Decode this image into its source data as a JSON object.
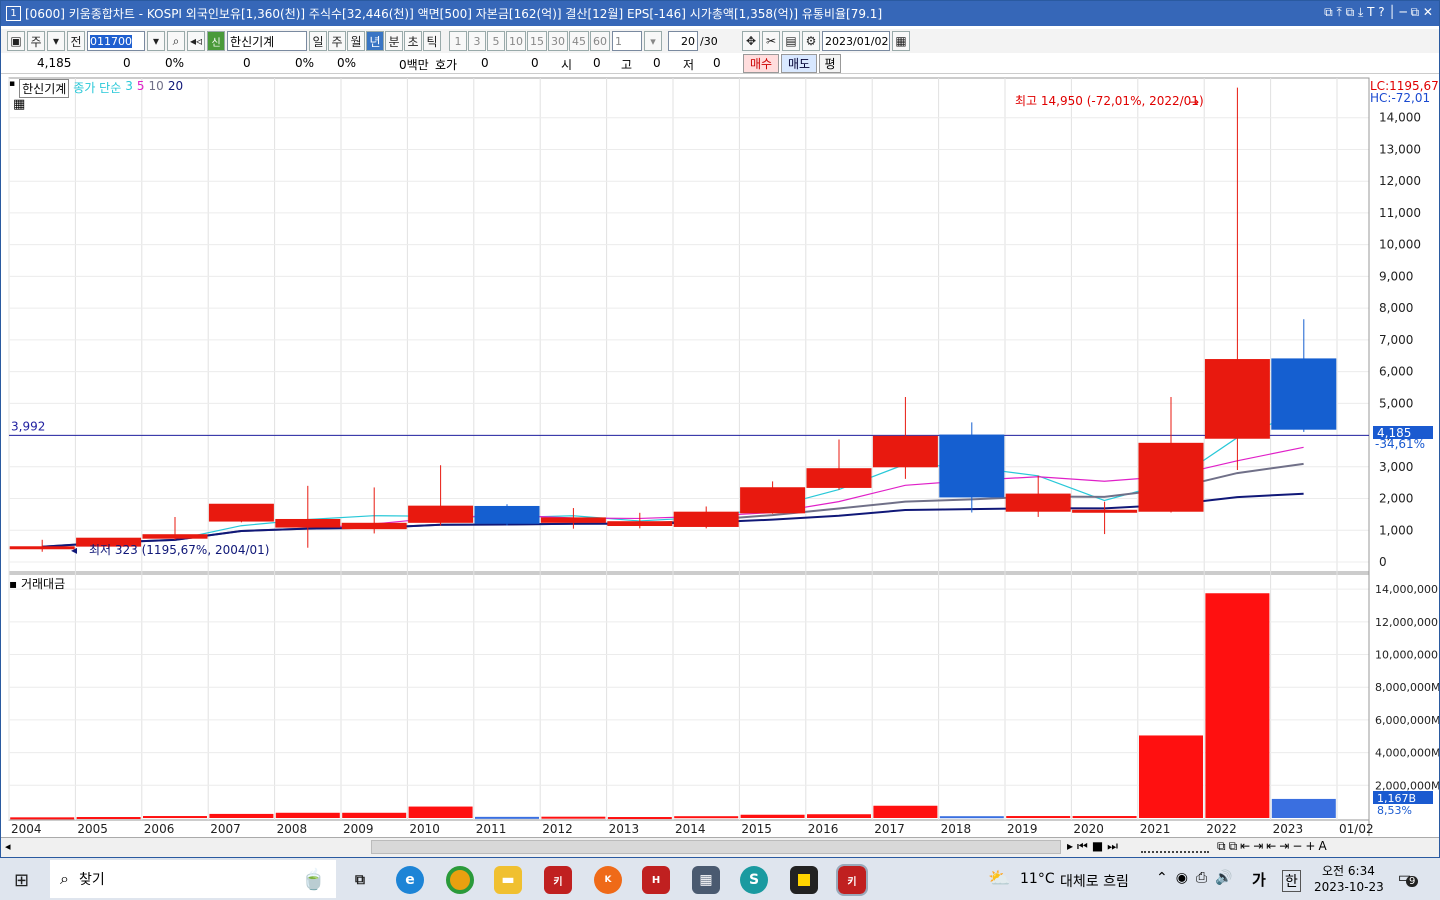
{
  "window": {
    "num": "1",
    "title": "[0600] 키움종합차트 - KOSPI 외국인보유[1,360(천)] 주식수[32,446(천)] 액면[500] 자본금[162(억)] 결산[12월] EPS[-146] 시가총액[1,358(억)] 유통비율[79.1]",
    "title_icons": "⧉ ⤒ ⧉ ⤓ T ? │ ─ ⧉ ✕"
  },
  "toolbar": {
    "mode": "주",
    "prev": "전",
    "code": "011700",
    "name": "한신기계",
    "new_badge": "신",
    "periods": [
      "일",
      "주",
      "월",
      "년",
      "분",
      "초",
      "틱"
    ],
    "selected_period": "년",
    "intervals": [
      "1",
      "3",
      "5",
      "10",
      "15",
      "30",
      "45",
      "60"
    ],
    "custom": "1",
    "count": "20",
    "count_total": "/30",
    "date": "2023/01/02"
  },
  "pricebar": {
    "price": "4,185",
    "change": "0",
    "rate": "0%",
    "volume": "0",
    "vrate": "0%",
    "vrate2": "0%",
    "amount": "0백만",
    "hoga_label": "호가",
    "hoga1": "0",
    "hoga2": "0",
    "open_label": "시",
    "open": "0",
    "high_label": "고",
    "high": "0",
    "low_label": "저",
    "low": "0",
    "buy": "매수",
    "sell": "매도",
    "pyeong": "평"
  },
  "legend": {
    "name": "한신기계",
    "ma_label": "종가 단순",
    "ma3": "3",
    "ma5": "5",
    "ma10": "10",
    "ma20": "20",
    "vol_label": "거래대금"
  },
  "labels": {
    "lc": "LC:1195,67",
    "hc": "HC:-72,01",
    "high": "최고 14,950 (-72,01%, 2022/01)",
    "low": "최저 323 (1195,67%, 2004/01)",
    "hline": "3,992",
    "cur_price": "4,185",
    "cur_rate": "-34,61%",
    "vol_cur": "1,167B",
    "vol_rate": "8,53%"
  },
  "colors": {
    "up": "#e8190f",
    "down": "#155fd0",
    "ma3": "#28c8d8",
    "ma5": "#e020c8",
    "ma10": "#707088",
    "ma20": "#101878",
    "hline": "#2020a0"
  },
  "chart_data": [
    {
      "type": "candlestick",
      "title": "",
      "x": [
        "2004",
        "2005",
        "2006",
        "2007",
        "2008",
        "2009",
        "2010",
        "2011",
        "2012",
        "2013",
        "2014",
        "2015",
        "2016",
        "2017",
        "2018",
        "2019",
        "2020",
        "2021",
        "2022",
        "2023"
      ],
      "open": [
        440,
        500,
        750,
        1290,
        1100,
        1050,
        1250,
        1750,
        1250,
        1150,
        1120,
        1550,
        2350,
        3000,
        4000,
        1600,
        1580,
        1600,
        3900,
        6400
      ],
      "high": [
        700,
        720,
        1420,
        1820,
        2400,
        2350,
        3050,
        1820,
        1700,
        1550,
        1750,
        2540,
        3860,
        5200,
        4400,
        2720,
        1900,
        5200,
        14950,
        7650
      ],
      "low": [
        323,
        420,
        700,
        1250,
        450,
        900,
        1150,
        1150,
        1050,
        1060,
        1060,
        1520,
        2280,
        2620,
        1560,
        1420,
        880,
        1560,
        2900,
        4100
      ],
      "close": [
        480,
        750,
        860,
        1820,
        1340,
        1220,
        1760,
        1220,
        1390,
        1270,
        1570,
        2340,
        2940,
        3960,
        2050,
        2140,
        1630,
        3740,
        6380,
        4185
      ],
      "ylim": [
        0,
        15000
      ],
      "yticks": [
        "0",
        "1,000",
        "2,000",
        "3,000",
        "4,000",
        "5,000",
        "6,000",
        "7,000",
        "8,000",
        "9,000",
        "10,000",
        "11,000",
        "12,000",
        "13,000",
        "14,000"
      ]
    },
    {
      "type": "bar",
      "title": "거래대금",
      "x": [
        "2004",
        "2005",
        "2006",
        "2007",
        "2008",
        "2009",
        "2010",
        "2011",
        "2012",
        "2013",
        "2014",
        "2015",
        "2016",
        "2017",
        "2018",
        "2019",
        "2020",
        "2021",
        "2022",
        "2023"
      ],
      "values": [
        40,
        60,
        120,
        250,
        320,
        320,
        700,
        70,
        80,
        60,
        110,
        200,
        230,
        750,
        110,
        120,
        120,
        5050,
        13750,
        1167
      ],
      "ylim": [
        0,
        14500
      ],
      "yticks": [
        "2,000,000M",
        "4,000,000M",
        "6,000,000M",
        "8,000,000M",
        "10,000,000M",
        "12,000,000M",
        "14,000,000M"
      ],
      "xlabels": [
        "2004",
        "2005",
        "2006",
        "2007",
        "2008",
        "2009",
        "2010",
        "2011",
        "2012",
        "2013",
        "2014",
        "2015",
        "2016",
        "2017",
        "2018",
        "2019",
        "2020",
        "2021",
        "2022",
        "2023",
        "01/02"
      ]
    }
  ],
  "taskbar": {
    "search": "찾기",
    "weather_temp": "11°C",
    "weather_text": "대체로 흐림",
    "ime": "가",
    "lang": "한",
    "time": "오전 6:34",
    "date": "2023-10-23",
    "notif": "9",
    "apps": [
      "task-view",
      "edge",
      "chrome",
      "explorer",
      "kiwoom",
      "kiwoom2",
      "kiwoom3",
      "calculator",
      "app-s",
      "sticky",
      "kiwoom-active"
    ]
  }
}
